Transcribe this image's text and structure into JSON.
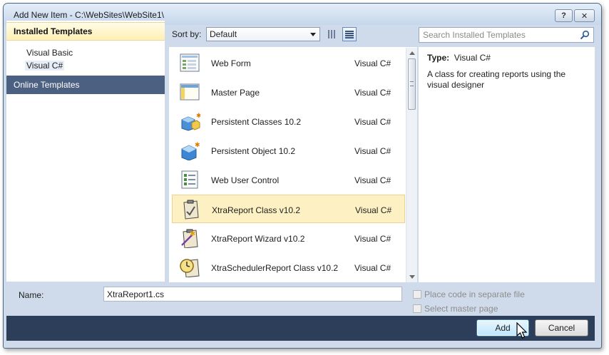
{
  "window": {
    "title": "Add New Item - C:\\WebSites\\WebSite1\\",
    "help_glyph": "?",
    "close_glyph": "✕"
  },
  "left_pane": {
    "installed_header": "Installed Templates",
    "items": [
      {
        "label": "Visual Basic"
      },
      {
        "label": "Visual C#"
      }
    ],
    "online_header": "Online Templates"
  },
  "toolbar": {
    "sort_label": "Sort by:",
    "sort_value": "Default",
    "search_placeholder": "Search Installed Templates"
  },
  "templates": [
    {
      "name": "Web Form",
      "lang": "Visual C#",
      "icon": "web-form-icon"
    },
    {
      "name": "Master Page",
      "lang": "Visual C#",
      "icon": "master-page-icon"
    },
    {
      "name": "Persistent Classes 10.2",
      "lang": "Visual C#",
      "icon": "persistent-classes-icon"
    },
    {
      "name": "Persistent Object 10.2",
      "lang": "Visual C#",
      "icon": "persistent-object-icon"
    },
    {
      "name": "Web User Control",
      "lang": "Visual C#",
      "icon": "web-user-control-icon"
    },
    {
      "name": "XtraReport Class v10.2",
      "lang": "Visual C#",
      "icon": "xtrareport-class-icon",
      "selected": true
    },
    {
      "name": "XtraReport Wizard v10.2",
      "lang": "Visual C#",
      "icon": "xtrareport-wizard-icon"
    },
    {
      "name": "XtraSchedulerReport Class v10.2",
      "lang": "Visual C#",
      "icon": "xtrascheduler-report-icon"
    }
  ],
  "details": {
    "type_label": "Type:",
    "type_value": "Visual C#",
    "description": "A class for creating reports using the visual designer"
  },
  "bottom": {
    "name_label": "Name:",
    "name_value": "XtraReport1.cs",
    "place_code_label": "Place code in separate file",
    "select_master_label": "Select master page",
    "add_label": "Add",
    "cancel_label": "Cancel"
  },
  "colors": {
    "accent": "#4c6182",
    "selection": "#fdf0c2",
    "footer": "#2d3e5a"
  }
}
